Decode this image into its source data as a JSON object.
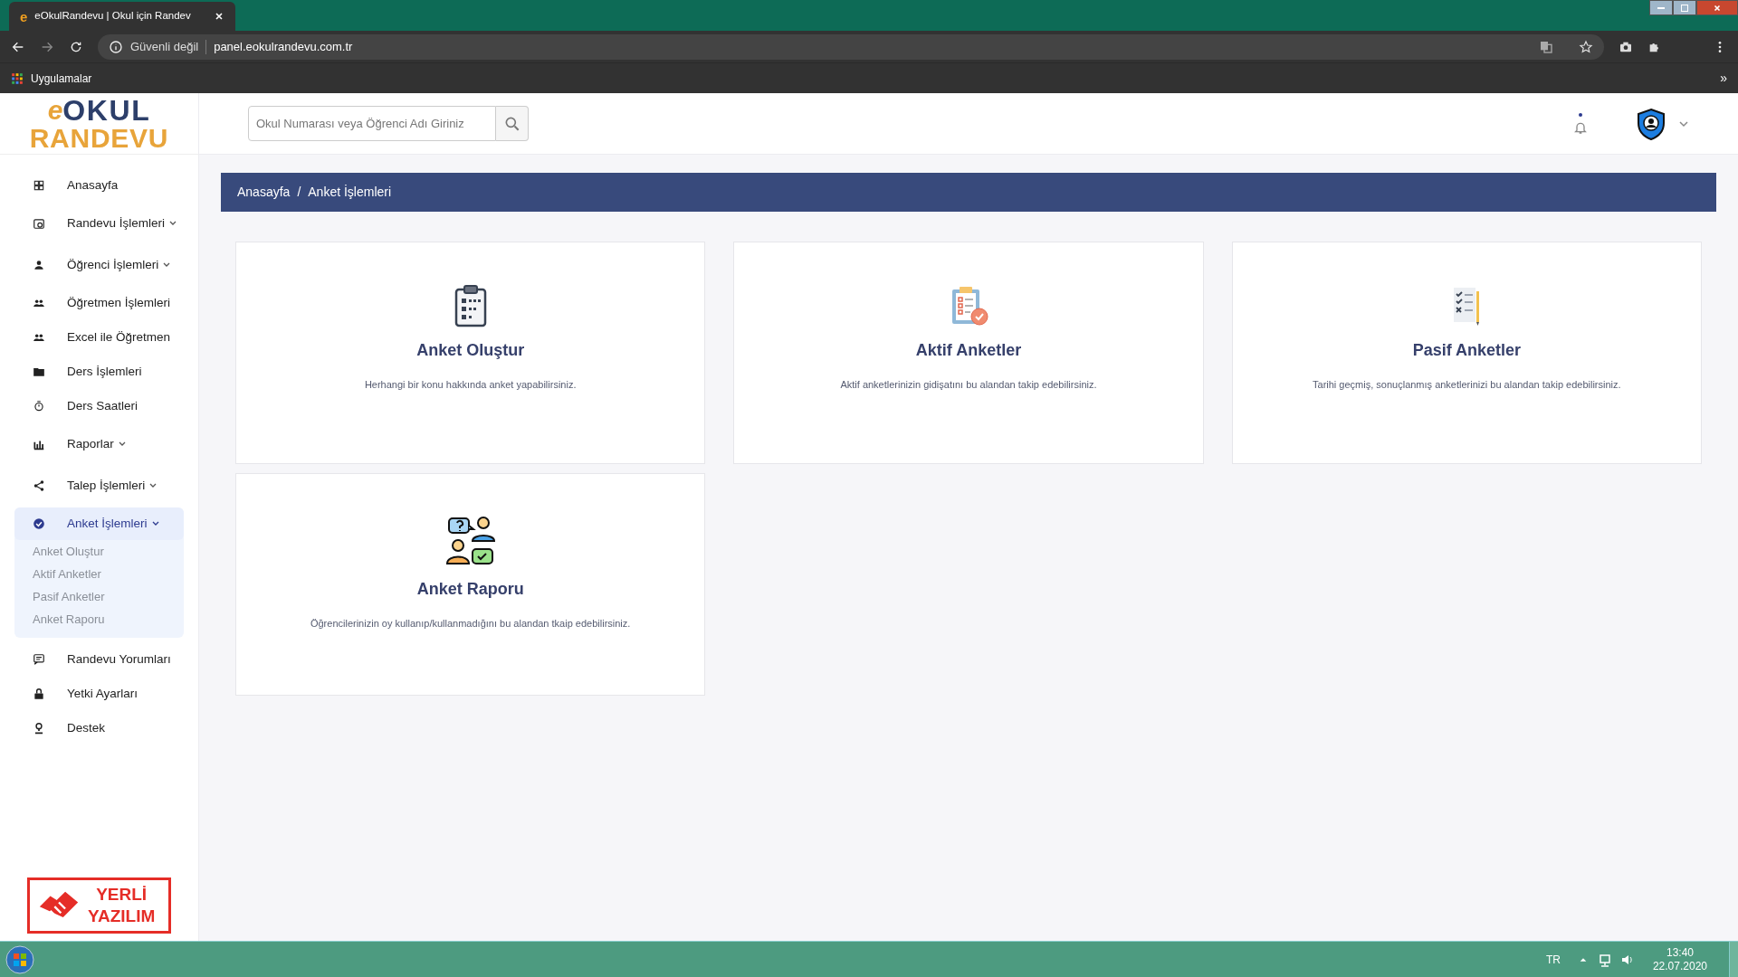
{
  "browser": {
    "tab_icon": "e",
    "tab_title": "eOkulRandevu | Okul için Randev",
    "security": "Güvenli değil",
    "url": "panel.eokulrandevu.com.tr",
    "bookmarks": [
      "Uygulamalar"
    ],
    "overflow": "»"
  },
  "header": {
    "logo_e": "e",
    "logo_top": "OKUL",
    "logo_bottom": "RANDEVU",
    "search": {
      "placeholder": "Okul Numarası veya Öğrenci Adı Giriniz"
    },
    "notification": true
  },
  "sidebar": {
    "items": [
      {
        "label": "Anasayfa",
        "selected": false,
        "submenu": false
      },
      {
        "label": "Randevu İşlemleri",
        "selected": false,
        "submenu": true,
        "expanded": false
      },
      {
        "label": "Öğrenci İşlemleri",
        "selected": false,
        "submenu": true,
        "expanded": false
      },
      {
        "label": "Öğretmen İşlemleri",
        "selected": false,
        "submenu": false
      },
      {
        "label": "Excel ile Öğretmen",
        "selected": false,
        "submenu": false
      },
      {
        "label": "Ders İşlemleri",
        "selected": false,
        "submenu": false
      },
      {
        "label": "Ders Saatleri",
        "selected": false,
        "submenu": false
      },
      {
        "label": "Raporlar",
        "selected": false,
        "submenu": true,
        "expanded": false
      },
      {
        "label": "Talep İşlemleri",
        "selected": false,
        "submenu": true,
        "expanded": false
      },
      {
        "label": "Anket İşlemleri",
        "selected": true,
        "submenu": true,
        "expanded": true,
        "children": [
          "Anket Oluştur",
          "Aktif Anketler",
          "Pasif Anketler",
          "Anket Raporu"
        ]
      },
      {
        "label": "Randevu Yorumları",
        "selected": false,
        "submenu": false
      },
      {
        "label": "Yetki Ayarları",
        "selected": false,
        "submenu": false
      },
      {
        "label": "Destek",
        "selected": false,
        "submenu": false
      }
    ],
    "badge": {
      "line1": "YERLİ",
      "line2": "YAZILIM"
    }
  },
  "breadcrumb": {
    "separator": "/",
    "items": [
      "Anasayfa",
      "Anket İşlemleri"
    ]
  },
  "cards": [
    {
      "title": "Anket Oluştur",
      "description": "Herhangi bir konu hakkında anket yapabilirsiniz."
    },
    {
      "title": "Aktif Anketler",
      "description": "Aktif anketlerinizin gidişatını bu alandan takip edebilirsiniz."
    },
    {
      "title": "Pasif Anketler",
      "description": "Tarihi geçmiş, sonuçlanmış anketlerinizi bu alandan takip edebilirsiniz."
    },
    {
      "title": "Anket Raporu",
      "description": "Öğrencilerinizin oy kullanıp/kullanmadığını bu alandan tkaip edebilirsiniz."
    }
  ],
  "taskbar": {
    "language": "TR",
    "time": "13:40",
    "date": "22.07.2020"
  }
}
